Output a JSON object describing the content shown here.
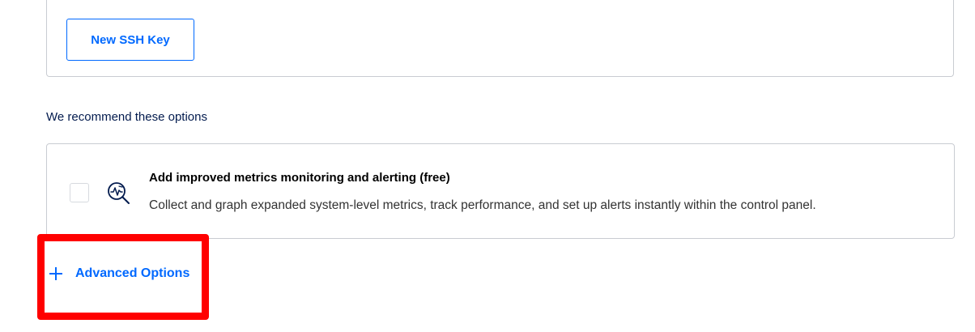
{
  "ssh_section": {
    "new_ssh_key_label": "New SSH Key"
  },
  "recommend": {
    "heading": "We recommend these options",
    "options": [
      {
        "title": "Add improved metrics monitoring and alerting (free)",
        "description": "Collect and graph expanded system-level metrics, track performance, and set up alerts instantly within the control panel.",
        "checked": false,
        "icon": "monitoring-magnifier-icon"
      }
    ]
  },
  "advanced": {
    "label": "Advanced Options",
    "icon": "plus-icon"
  },
  "colors": {
    "accent": "#0069ff",
    "heading": "#031b4e",
    "highlight": "#ff0000",
    "border": "#c9ccd2"
  }
}
